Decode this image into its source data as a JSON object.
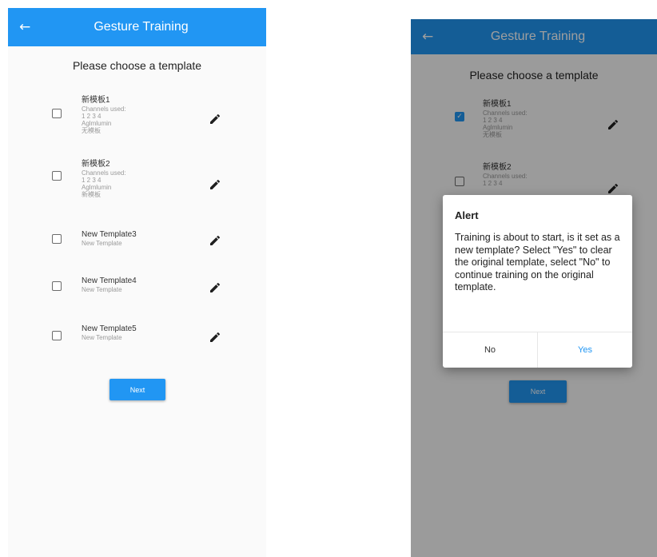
{
  "app": {
    "title": "Gesture Training",
    "back_icon": "←",
    "accent_color": "#2196f3"
  },
  "prompt": "Please choose a template",
  "templates": [
    {
      "name": "新模板1",
      "lines": [
        "Channels used:",
        "1 2 3 4",
        "Aglmlumin",
        "无模板"
      ]
    },
    {
      "name": "新模板2",
      "lines": [
        "Channels used:",
        "1 2 3 4",
        "Aglmlumin",
        "新模板"
      ]
    },
    {
      "name": "New Template3",
      "lines": [
        "New Template"
      ]
    },
    {
      "name": "New Template4",
      "lines": [
        "New Template"
      ]
    },
    {
      "name": "New Template5",
      "lines": [
        "New Template"
      ]
    }
  ],
  "check_glyph": "✓",
  "next_label": "Next",
  "dialog": {
    "title": "Alert",
    "message": "Training is about to start, is it set as a new template? Select \"Yes\" to clear the original template, select \"No\" to continue training on the original template.",
    "no_label": "No",
    "yes_label": "Yes"
  }
}
